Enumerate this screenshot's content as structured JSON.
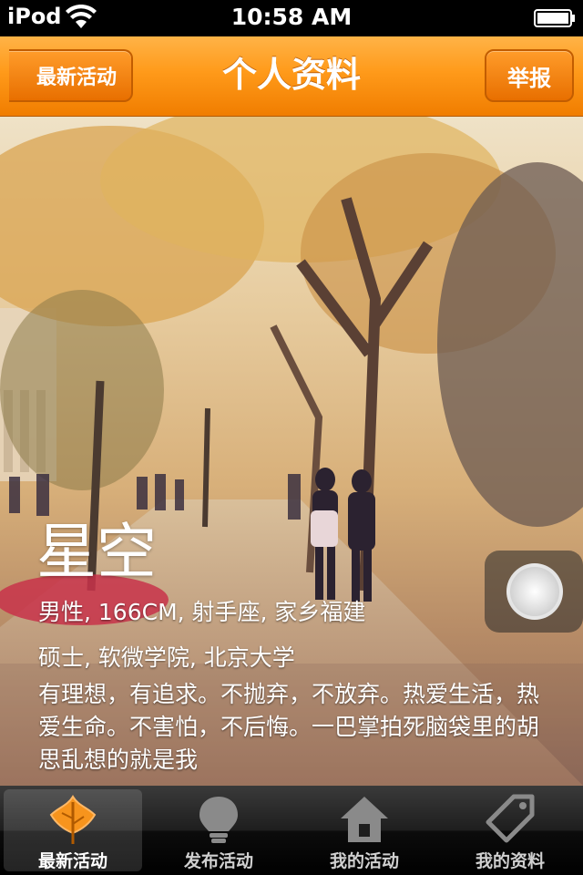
{
  "status_bar": {
    "carrier": "iPod",
    "time": "10:58 AM"
  },
  "nav": {
    "back_label": "最新活动",
    "title": "个人资料",
    "report_label": "举报"
  },
  "profile": {
    "name": "星空",
    "basic_info": "男性, 166CM, 射手座, 家乡福建",
    "education": "硕士, 软微学院, 北京大学",
    "bio": "有理想，有追求。不抛弃，不放弃。热爱生活，热爱生命。不害怕，不后悔。一巴掌拍死脑袋里的胡思乱想的就是我"
  },
  "tabs": [
    {
      "label": "最新活动",
      "icon": "leaf-icon",
      "active": true
    },
    {
      "label": "发布活动",
      "icon": "lightbulb-icon",
      "active": false
    },
    {
      "label": "我的活动",
      "icon": "home-icon",
      "active": false
    },
    {
      "label": "我的资料",
      "icon": "tag-icon",
      "active": false
    }
  ],
  "colors": {
    "nav_orange": "#ff9a1a",
    "nav_orange_dark": "#e86f00",
    "leaf_orange": "#f7941d"
  }
}
